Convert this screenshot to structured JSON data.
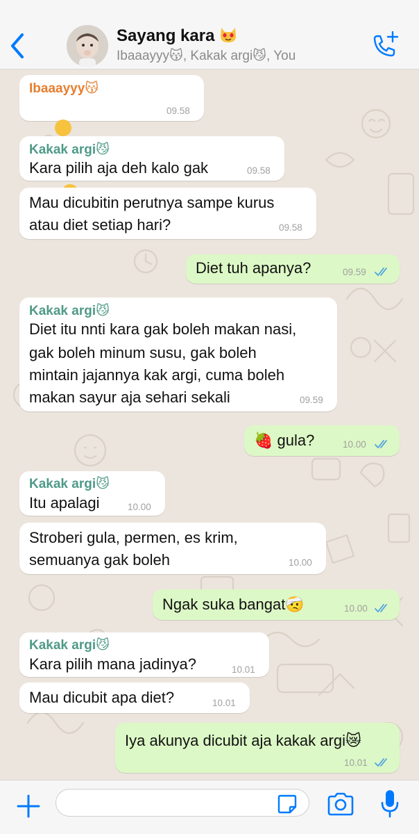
{
  "header": {
    "title": "Sayang kara",
    "title_emoji": "heart-eyes-cat",
    "subtitle": "Ibaaayyy😽, Kakak argi😼, You"
  },
  "colors": {
    "incoming": "#ffffff",
    "outgoing": "#dcf8c6",
    "background": "#ece5dd",
    "accent_blue": "#007aff",
    "sender_ibaaayyy": "#e57e2e",
    "sender_kakak_argi": "#4f9a87",
    "read_ticks": "#4fa3e2"
  },
  "messages": [
    {
      "sender": "Ibaaayyy😽",
      "lines": [
        "😅😅😅😅😅"
      ],
      "time": "09.58"
    },
    {
      "sender": "Kakak argi😼",
      "lines": [
        "Kara pilih aja deh kalo gak"
      ],
      "time": "09.58"
    },
    {
      "lines": [
        "Mau dicubitin perutnya sampe kurus",
        "atau diet setiap hari?"
      ],
      "time": "09.58"
    },
    {
      "lines": [
        "Diet tuh apanya?"
      ],
      "time": "09.59",
      "status": "read"
    },
    {
      "sender": "Kakak argi😼",
      "lines": [
        "Diet itu nnti kara gak boleh makan nasi,",
        "gak boleh minum susu, gak boleh",
        "mintain jajannya kak argi, cuma boleh",
        "makan sayur aja sehari sekali"
      ],
      "time": "09.59"
    },
    {
      "lines": [
        "🍓 gula?"
      ],
      "time": "10.00",
      "status": "read"
    },
    {
      "sender": "Kakak argi😼",
      "lines": [
        "Itu apalagi"
      ],
      "time": "10.00"
    },
    {
      "lines": [
        "Stroberi gula, permen, es krim,",
        "semuanya gak boleh"
      ],
      "time": "10.00"
    },
    {
      "lines": [
        "Ngak suka bangat🤕"
      ],
      "time": "10.00",
      "status": "read"
    },
    {
      "sender": "Kakak argi😼",
      "lines": [
        "Kara pilih mana jadinya?"
      ],
      "time": "10.01"
    },
    {
      "lines": [
        "Mau dicubit apa diet?"
      ],
      "time": "10.01"
    },
    {
      "lines": [
        "Iya akunya dicubit aja kakak argi😿"
      ],
      "time": "10.01",
      "status": "read"
    }
  ],
  "footer": {
    "icons": [
      "plus-icon",
      "sticker-icon",
      "camera-icon",
      "microphone-icon"
    ],
    "input_value": ""
  }
}
